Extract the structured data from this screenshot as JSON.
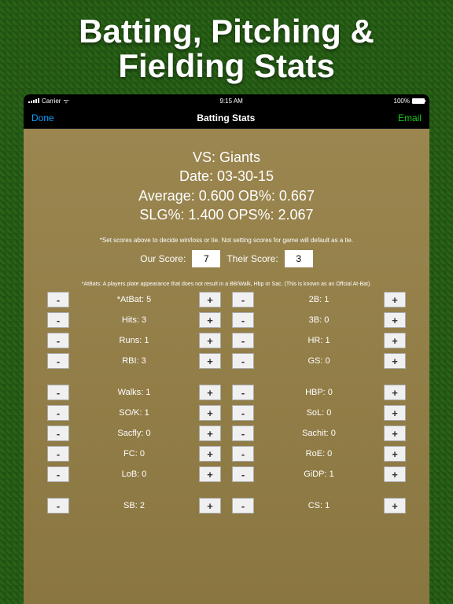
{
  "hero": {
    "line1": "Batting, Pitching &",
    "line2": "Fielding Stats"
  },
  "statusbar": {
    "carrier": "Carrier",
    "wifi": "ᯤ",
    "time": "9:15 AM",
    "battery": "100%"
  },
  "navbar": {
    "done": "Done",
    "title": "Batting Stats",
    "email": "Email"
  },
  "header": {
    "vs": "VS: Giants",
    "date": "Date: 03-30-15",
    "avg": "Average: 0.600    OB%: 0.667",
    "slg": "SLG%: 1.400    OPS%: 2.067"
  },
  "note1": "*Set scores above to decide win/loss or tie. Not setting scores for game will default as a tie.",
  "scores": {
    "our_label": "Our Score:",
    "our": "7",
    "their_label": "Their Score:",
    "their": "3"
  },
  "note2": "*AtBats: A players plate appearance that does not result in a BB/Walk, Hbp or  Sac. (This is known as an Offcial At-Bat).",
  "groups": [
    [
      {
        "l": "*AtBat: 5",
        "r": "2B: 1"
      },
      {
        "l": "Hits: 3",
        "r": "3B: 0"
      },
      {
        "l": "Runs: 1",
        "r": "HR: 1"
      },
      {
        "l": "RBI: 3",
        "r": "GS: 0"
      }
    ],
    [
      {
        "l": "Walks: 1",
        "r": "HBP: 0"
      },
      {
        "l": "SO/K: 1",
        "r": "SoL: 0"
      },
      {
        "l": "Sacfly: 0",
        "r": "Sachit: 0"
      },
      {
        "l": "FC: 0",
        "r": "RoE: 0"
      },
      {
        "l": "LoB: 0",
        "r": "GiDP: 1"
      }
    ],
    [
      {
        "l": "SB: 2",
        "r": "CS: 1"
      }
    ]
  ],
  "btn": {
    "minus": "-",
    "plus": "+"
  }
}
